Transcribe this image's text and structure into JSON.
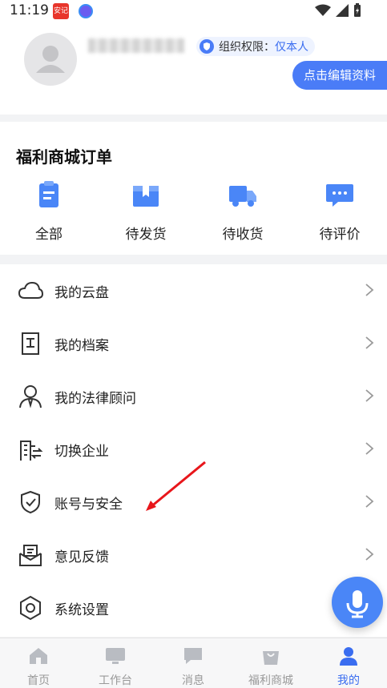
{
  "status_bar": {
    "time": "11:19",
    "app1_badge": "安记"
  },
  "profile": {
    "permission_label": "组织权限：",
    "permission_value": "仅本人",
    "edit_button": "点击编辑资料"
  },
  "orders": {
    "title": "福利商城订单",
    "items": [
      {
        "label": "全部",
        "icon": "clipboard-icon"
      },
      {
        "label": "待发货",
        "icon": "box-icon"
      },
      {
        "label": "待收货",
        "icon": "truck-icon"
      },
      {
        "label": "待评价",
        "icon": "chat-icon"
      }
    ]
  },
  "menu": [
    {
      "label": "我的云盘",
      "icon": "cloud-icon"
    },
    {
      "label": "我的档案",
      "icon": "archive-icon"
    },
    {
      "label": "我的法律顾问",
      "icon": "lawyer-icon"
    },
    {
      "label": "切换企业",
      "icon": "switch-company-icon"
    },
    {
      "label": "账号与安全",
      "icon": "shield-icon"
    },
    {
      "label": "意见反馈",
      "icon": "feedback-icon"
    },
    {
      "label": "系统设置",
      "icon": "settings-icon"
    }
  ],
  "tabbar": [
    {
      "label": "首页"
    },
    {
      "label": "工作台"
    },
    {
      "label": "消息"
    },
    {
      "label": "福利商城"
    },
    {
      "label": "我的"
    }
  ],
  "colors": {
    "accent": "#3a6df0",
    "button": "#4a7cf7",
    "annotation_arrow": "#e8161b"
  }
}
